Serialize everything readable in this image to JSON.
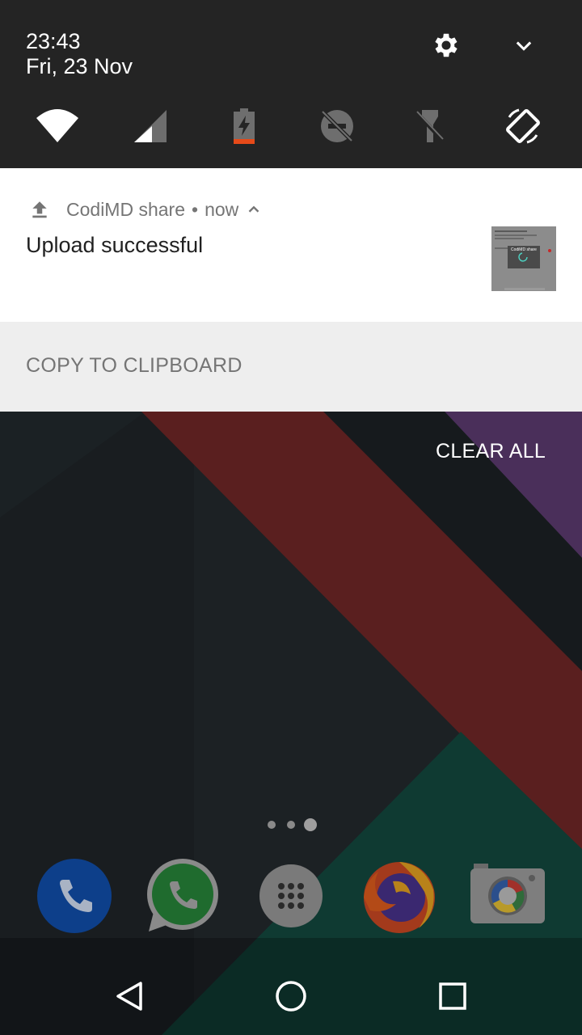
{
  "status": {
    "time": "23:43",
    "date": "Fri, 23 Nov"
  },
  "quick_settings": {
    "tiles": [
      {
        "icon": "wifi-icon"
      },
      {
        "icon": "cellular-signal-icon"
      },
      {
        "icon": "battery-charging-icon"
      },
      {
        "icon": "do-not-disturb-off-icon"
      },
      {
        "icon": "flashlight-off-icon"
      },
      {
        "icon": "auto-rotate-icon"
      }
    ],
    "settings_icon": "gear-icon",
    "expand_icon": "chevron-down-icon"
  },
  "notification": {
    "app_icon": "upload-icon",
    "app_name": "CodiMD share",
    "separator": "•",
    "when": "now",
    "title": "Upload successful",
    "thumbnail": {
      "app_label": "CodiMD share"
    },
    "action": "COPY TO CLIPBOARD"
  },
  "clear_all": "CLEAR ALL",
  "dock": {
    "apps": [
      {
        "name": "Phone",
        "icon": "phone-icon"
      },
      {
        "name": "WhatsApp",
        "icon": "whatsapp-icon"
      },
      {
        "name": "Apps",
        "icon": "app-drawer-icon"
      },
      {
        "name": "Firefox",
        "icon": "firefox-icon"
      },
      {
        "name": "Camera",
        "icon": "camera-icon"
      }
    ]
  },
  "colors": {
    "panel": "#242424",
    "notification_bg": "#ffffff",
    "action_bg": "#eeeeee",
    "wallpaper_red": "#5a1f1f",
    "wallpaper_teal": "#0f3a32",
    "wallpaper_purple": "#4a2f5a"
  }
}
